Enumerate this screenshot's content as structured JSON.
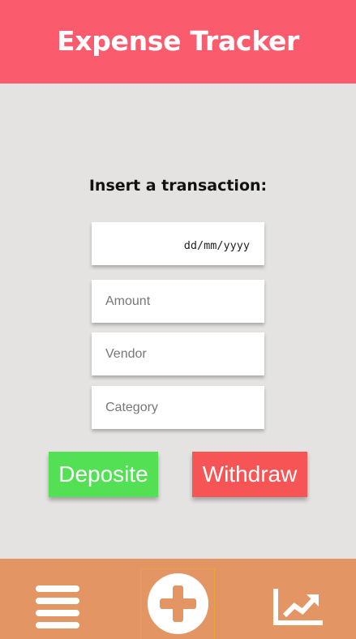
{
  "app": {
    "title": "Expense Tracker"
  },
  "form": {
    "heading": "Insert a transaction:",
    "date_placeholder": "dd/mm/yyyy",
    "amount_placeholder": "Amount",
    "vendor_placeholder": "Vendor",
    "category_placeholder": "Category"
  },
  "actions": {
    "deposit_label": "Deposite",
    "withdraw_label": "Withdraw"
  },
  "nav": {
    "items": [
      {
        "icon": "menu-icon"
      },
      {
        "icon": "add-circle-icon",
        "active": true
      },
      {
        "icon": "chart-trend-icon"
      }
    ]
  },
  "colors": {
    "header": "#fa5c6e",
    "background": "#e4e3e2",
    "footer": "#e39563",
    "deposit": "#53e055",
    "withdraw": "#f75555",
    "active_outline": "#e8a53e"
  }
}
